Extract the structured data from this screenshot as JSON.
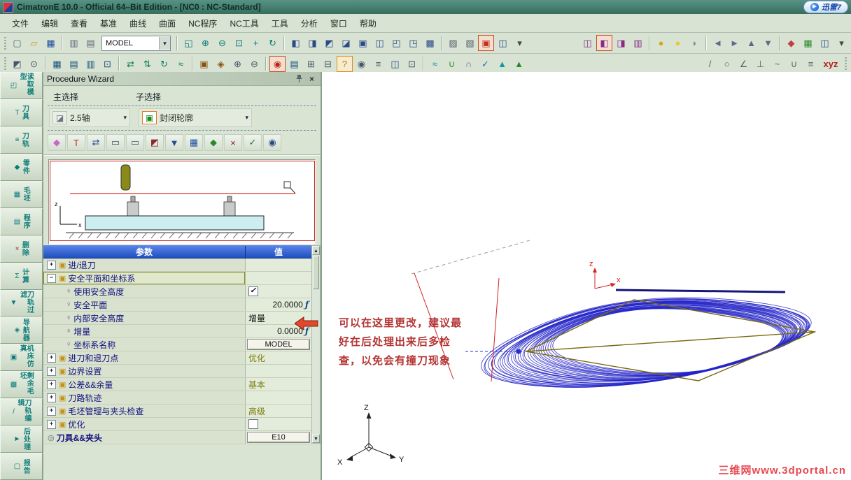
{
  "window": {
    "title": "CimatronE 10.0 - Official 64–Bit Edition - [NC0 : NC-Standard]"
  },
  "thunder": {
    "label": "迅雷7",
    "icon_glyph": "▶"
  },
  "ui": {
    "dropdown_arrow": "▾",
    "arrow_up": "▲",
    "arrow_down": "▼",
    "close_glyph": "×"
  },
  "menu": {
    "items": [
      {
        "label": "文件",
        "name": "menu-file"
      },
      {
        "label": "编辑",
        "name": "menu-edit"
      },
      {
        "label": "查看",
        "name": "menu-view"
      },
      {
        "label": "基准",
        "name": "menu-datum"
      },
      {
        "label": "曲线",
        "name": "menu-curves"
      },
      {
        "label": "曲面",
        "name": "menu-surfaces"
      },
      {
        "label": "NC程序",
        "name": "menu-nc-program"
      },
      {
        "label": "NC工具",
        "name": "menu-nc-tools"
      },
      {
        "label": "工具",
        "name": "menu-tools"
      },
      {
        "label": "分析",
        "name": "menu-analysis"
      },
      {
        "label": "窗口",
        "name": "menu-window"
      },
      {
        "label": "帮助",
        "name": "menu-help"
      }
    ]
  },
  "toolbar1": {
    "model_combo": "MODEL",
    "file_icons": [
      {
        "name": "new-file-icon",
        "g": "▢",
        "c": "#566a7a"
      },
      {
        "name": "open-file-icon",
        "g": "▱",
        "c": "#c8961e"
      },
      {
        "name": "save-icon",
        "g": "▦",
        "c": "#1e50a0"
      }
    ],
    "doc_icons": [
      {
        "name": "print-icon",
        "g": "▥",
        "c": "#5a6a7a"
      },
      {
        "name": "screen-icon",
        "g": "▤",
        "c": "#5a6a7a"
      }
    ],
    "view_icons": [
      {
        "name": "zoom-fit-icon",
        "g": "◱",
        "c": "#0a7878"
      },
      {
        "name": "zoom-in-icon",
        "g": "⊕",
        "c": "#0a7878"
      },
      {
        "name": "zoom-out-icon",
        "g": "⊖",
        "c": "#0a7878"
      },
      {
        "name": "zoom-window-icon",
        "g": "⊡",
        "c": "#0a7878"
      },
      {
        "name": "pan-icon",
        "g": "+",
        "c": "#0a7878"
      },
      {
        "name": "rotate-view-icon",
        "g": "↻",
        "c": "#0a7878"
      }
    ],
    "display_icons": [
      {
        "name": "shade-icon",
        "g": "◧",
        "c": "#2a4a8a"
      },
      {
        "name": "wireframe-icon",
        "g": "◨",
        "c": "#2a4a8a"
      },
      {
        "name": "hidden-line-icon",
        "g": "◩",
        "c": "#2a4a8a"
      },
      {
        "name": "transparent-icon",
        "g": "◪",
        "c": "#2a4a8a"
      },
      {
        "name": "box-icon",
        "g": "▣",
        "c": "#2a4a8a"
      },
      {
        "name": "section-icon",
        "g": "◫",
        "c": "#2a4a8a"
      },
      {
        "name": "view-iso-icon",
        "g": "◰",
        "c": "#2a4a8a"
      },
      {
        "name": "view-top-icon",
        "g": "◳",
        "c": "#2a4a8a"
      },
      {
        "name": "grid-icon",
        "g": "▩",
        "c": "#2a4a8a"
      }
    ],
    "edit_icons": [
      {
        "name": "hatch-icon",
        "g": "▨",
        "c": "#556070"
      },
      {
        "name": "mask-icon",
        "g": "▧",
        "c": "#556070"
      }
    ],
    "active_icons": [
      {
        "name": "active-tool-icon",
        "g": "▣",
        "c": "#c03018",
        "hl": "hl"
      },
      {
        "name": "window-cube-icon",
        "g": "◫",
        "c": "#2a4a8a"
      },
      {
        "name": "more-dropdown-icon",
        "g": "▾",
        "c": "#444"
      }
    ],
    "purple_icons": [
      {
        "name": "layer-icon",
        "g": "◫",
        "c": "#8a2a8a"
      },
      {
        "name": "filter-icon",
        "g": "◧",
        "c": "#8a2a8a",
        "hl": "hl"
      },
      {
        "name": "entity-mask-icon",
        "g": "◨",
        "c": "#8a2a8a"
      },
      {
        "name": "groups-icon",
        "g": "▥",
        "c": "#8a2a8a"
      }
    ],
    "light_icons": [
      {
        "name": "bulb-on-icon",
        "g": "●",
        "c": "#d8a818"
      },
      {
        "name": "bulb-off-icon",
        "g": "●",
        "c": "#e8c838"
      },
      {
        "name": "glasses-icon",
        "g": "◗",
        "c": "#7a8a9a"
      }
    ],
    "nav_icons": [
      {
        "name": "prev-icon",
        "g": "◄",
        "c": "#5a6a8a"
      },
      {
        "name": "next-icon",
        "g": "►",
        "c": "#5a6a8a"
      },
      {
        "name": "up-icon",
        "g": "▲",
        "c": "#5a6a8a"
      },
      {
        "name": "down-icon",
        "g": "▼",
        "c": "#5a6a8a"
      }
    ],
    "misc_icons": [
      {
        "name": "render-icon",
        "g": "◆",
        "c": "#c04040"
      },
      {
        "name": "table-icon",
        "g": "▦",
        "c": "#2a8a2a"
      },
      {
        "name": "window-icon",
        "g": "◫",
        "c": "#2a4a8a"
      },
      {
        "name": "more-icon",
        "g": "▾",
        "c": "#444"
      }
    ]
  },
  "toolbar2": {
    "a": [
      {
        "name": "select-icon",
        "g": "◩",
        "c": "#44566a"
      },
      {
        "name": "pick-icon",
        "g": "⊙",
        "c": "#44566a"
      }
    ],
    "b": [
      {
        "name": "points-icon",
        "g": "▦",
        "c": "#14507a"
      },
      {
        "name": "lines-icon",
        "g": "▤",
        "c": "#14507a"
      },
      {
        "name": "planes-icon",
        "g": "▥",
        "c": "#14507a"
      },
      {
        "name": "solids-icon",
        "g": "⊡",
        "c": "#14507a"
      }
    ],
    "c": [
      {
        "name": "swap-icon",
        "g": "⇄",
        "c": "#0a7a5a"
      },
      {
        "name": "flip-icon",
        "g": "⇅",
        "c": "#0a7a5a"
      },
      {
        "name": "regen-icon",
        "g": "↻",
        "c": "#0a7a5a"
      },
      {
        "name": "smooth-icon",
        "g": "≈",
        "c": "#0a7a5a"
      }
    ],
    "d": [
      {
        "name": "stock-icon",
        "g": "▣",
        "c": "#8a5210"
      },
      {
        "name": "fixture-icon",
        "g": "◈",
        "c": "#8a5210"
      },
      {
        "name": "add-icon",
        "g": "⊕",
        "c": "#44556a"
      },
      {
        "name": "remove-icon",
        "g": "⊖",
        "c": "#44556a"
      }
    ],
    "e": [
      {
        "name": "active-proc-icon",
        "g": "◉",
        "c": "#c02010",
        "hl": "hl"
      },
      {
        "name": "report-icon",
        "g": "▤",
        "c": "#14507a"
      },
      {
        "name": "expand-icon",
        "g": "⊞",
        "c": "#44566a"
      },
      {
        "name": "collapse-icon",
        "g": "⊟",
        "c": "#44566a"
      },
      {
        "name": "help-icon",
        "g": "?",
        "c": "#b08000",
        "hl": "hlo"
      },
      {
        "name": "info-icon",
        "g": "◉",
        "c": "#44556a"
      },
      {
        "name": "list-icon",
        "g": "≡",
        "c": "#44556a"
      },
      {
        "name": "split-icon",
        "g": "◫",
        "c": "#2a4a8a"
      },
      {
        "name": "cell-icon",
        "g": "⊡",
        "c": "#44556a"
      }
    ],
    "f": [
      {
        "name": "surface-wave-icon",
        "g": "≈",
        "c": "#0a9aa0"
      },
      {
        "name": "curve-icon",
        "g": "∪",
        "c": "#2a8a2a"
      },
      {
        "name": "arc-icon",
        "g": "∩",
        "c": "#7a5ab0"
      },
      {
        "name": "verify-icon",
        "g": "✓",
        "c": "#2a6ab0"
      },
      {
        "name": "normal-icon",
        "g": "▲",
        "c": "#0a9aa0"
      },
      {
        "name": "draft-icon",
        "g": "▲",
        "c": "#2a8a2a"
      }
    ],
    "g": [
      {
        "name": "line-icon",
        "g": "/",
        "c": "#556070"
      },
      {
        "name": "circle-icon",
        "g": "○",
        "c": "#556070"
      },
      {
        "name": "angle-icon",
        "g": "∠",
        "c": "#556070"
      },
      {
        "name": "perpendicular-icon",
        "g": "⊥",
        "c": "#556070"
      },
      {
        "name": "spline-icon",
        "g": "~",
        "c": "#556070"
      },
      {
        "name": "arc2-icon",
        "g": "∪",
        "c": "#556070"
      },
      {
        "name": "measure-icon",
        "g": "≡",
        "c": "#556070"
      },
      {
        "name": "xyz-icon",
        "g": "xyz",
        "c": "#b02020",
        "hl": "wide"
      }
    ]
  },
  "sidebar": {
    "items": [
      {
        "label": "读取模型",
        "name": "sidebar-item-read-model",
        "g": "◰",
        "c": "#0a7a7a"
      },
      {
        "label": "刀具",
        "name": "sidebar-item-cutters",
        "g": "T",
        "c": "#0a7a7a"
      },
      {
        "label": "刀轨",
        "name": "sidebar-item-toolpath",
        "g": "≡",
        "c": "#0a7a7a"
      },
      {
        "label": "零件",
        "name": "sidebar-item-part",
        "g": "◆",
        "c": "#0a7a7a"
      },
      {
        "label": "毛坯",
        "name": "sidebar-item-stock",
        "g": "▦",
        "c": "#0a7a7a"
      },
      {
        "label": "程序",
        "name": "sidebar-item-procedures",
        "g": "▤",
        "c": "#0a7a7a"
      },
      {
        "label": "删除",
        "name": "sidebar-item-delete",
        "g": "×",
        "c": "#a02020"
      },
      {
        "label": "计算",
        "name": "sidebar-item-execute",
        "g": "Σ",
        "c": "#0a7a7a"
      },
      {
        "label": "刀轨过滤",
        "name": "sidebar-item-toolpath-filter",
        "g": "▼",
        "c": "#0a7a7a"
      },
      {
        "label": "导航器",
        "name": "sidebar-item-navigator",
        "g": "◈",
        "c": "#0a7a7a"
      },
      {
        "label": "机床仿真",
        "name": "sidebar-item-machine-simulation",
        "g": "▣",
        "c": "#0a7a7a"
      },
      {
        "label": "剩余毛坯",
        "name": "sidebar-item-remaining-stock",
        "g": "▩",
        "c": "#0a7a7a"
      },
      {
        "label": "刀轨编辑",
        "name": "sidebar-item-toolpath-editor",
        "g": "/",
        "c": "#0a7a7a"
      },
      {
        "label": "后处理",
        "name": "sidebar-item-post-process",
        "g": "►",
        "c": "#0a7a7a"
      },
      {
        "label": "报告",
        "name": "sidebar-item-report",
        "g": "▢",
        "c": "#0a7a7a"
      }
    ]
  },
  "wizard": {
    "title": "Procedure Wizard",
    "main_select_label": "主选择",
    "sub_select_label": "子选择",
    "main_select_value": "2.5轴",
    "main_select_icon": "◪",
    "sub_select_value": "封闭轮廓",
    "sub_select_icon": "▣",
    "icons": [
      {
        "name": "geometry-icon",
        "g": "◆",
        "c": "#c868c8"
      },
      {
        "name": "tool-icon",
        "g": "T",
        "c": "#c03018"
      },
      {
        "name": "trajectory-icon",
        "g": "⇄",
        "c": "#2a4a8a"
      },
      {
        "name": "machine-icon",
        "g": "▭",
        "c": "#44566a"
      },
      {
        "name": "monitor-icon",
        "g": "▭",
        "c": "#44566a"
      },
      {
        "name": "stock-check-icon",
        "g": "◩",
        "c": "#8a2a2a"
      },
      {
        "name": "down-icon",
        "g": "▼",
        "c": "#2a4a8a"
      },
      {
        "name": "save-proc-icon",
        "g": "▦",
        "c": "#1e50a0"
      },
      {
        "name": "sim-icon",
        "g": "◆",
        "c": "#2a8a2a"
      },
      {
        "name": "cut-icon",
        "g": "×",
        "c": "#8a2020"
      },
      {
        "name": "apply-icon",
        "g": "✓",
        "c": "#2a6a2a"
      },
      {
        "name": "execute-icon",
        "g": "◉",
        "c": "#2a4a8a"
      }
    ],
    "preview_axes": {
      "z": "z",
      "x": "x"
    },
    "table": {
      "param_header": "参数",
      "value_header": "值",
      "fx_glyph": "ƒ",
      "rows": [
        {
          "kind": "group",
          "exp": "+",
          "icon": "▣",
          "iconc": "#c89018",
          "label": "进/退刀",
          "vclass": "",
          "value": ""
        },
        {
          "kind": "group selected",
          "exp": "−",
          "icon": "▣",
          "iconc": "#c89018",
          "label": "安全平面和坐标系",
          "vclass": "",
          "value": ""
        },
        {
          "kind": "leaf",
          "exp": "",
          "icon": "♀",
          "iconc": "#8a4a9a",
          "label": "使用安全高度",
          "vclass": "check on",
          "value": ""
        },
        {
          "kind": "leaf",
          "exp": "",
          "icon": "♀",
          "iconc": "#8a4a9a",
          "label": "安全平面",
          "vclass": "num f",
          "value": "20.0000"
        },
        {
          "kind": "leaf",
          "exp": "",
          "icon": "♀",
          "iconc": "#8a4a9a",
          "label": "内部安全高度",
          "vclass": "text",
          "value": "增量"
        },
        {
          "kind": "leaf",
          "exp": "",
          "icon": "♀",
          "iconc": "#8a4a9a",
          "label": "增量",
          "vclass": "num f",
          "value": "0.0000"
        },
        {
          "kind": "leaf",
          "exp": "",
          "icon": "♀",
          "iconc": "#8a4a9a",
          "label": "坐标系名称",
          "vclass": "btn",
          "value": "MODEL"
        },
        {
          "kind": "group",
          "exp": "+",
          "icon": "▣",
          "iconc": "#c89018",
          "label": "进刀和退刀点",
          "vclass": "olive",
          "value": "优化"
        },
        {
          "kind": "group",
          "exp": "+",
          "icon": "▣",
          "iconc": "#c89018",
          "label": "边界设置",
          "vclass": "",
          "value": ""
        },
        {
          "kind": "group",
          "exp": "+",
          "icon": "▣",
          "iconc": "#c89018",
          "label": "公差&&余量",
          "vclass": "olive",
          "value": "基本"
        },
        {
          "kind": "group",
          "exp": "+",
          "icon": "▣",
          "iconc": "#c89018",
          "label": "刀路轨迹",
          "vclass": "",
          "value": ""
        },
        {
          "kind": "group",
          "exp": "+",
          "icon": "▣",
          "iconc": "#c89018",
          "label": "毛坯管理与夹头检查",
          "vclass": "olive",
          "value": "高级"
        },
        {
          "kind": "group",
          "exp": "+",
          "icon": "▣",
          "iconc": "#c89018",
          "label": "优化",
          "vclass": "check off",
          "value": ""
        },
        {
          "kind": "tool",
          "exp": "",
          "icon": "◎",
          "iconc": "#5a6a7a",
          "label": "刀具&&夹头",
          "vclass": "btn",
          "value": "E10"
        }
      ]
    }
  },
  "annotation": {
    "lines": [
      "可以在这里更改，建议最",
      "好在后处理出来后多检",
      "查，以免会有撞刀现象"
    ]
  },
  "watermark": "三维网www.3dportal.cn",
  "viewport": {
    "colors": {
      "toolpath": "#2525c8",
      "profile": "#7a6a10",
      "guide": "#d42222"
    },
    "ucs": {
      "z": "z",
      "x": "x"
    },
    "triad": {
      "x": "X",
      "y": "Y",
      "z": "Z"
    }
  }
}
